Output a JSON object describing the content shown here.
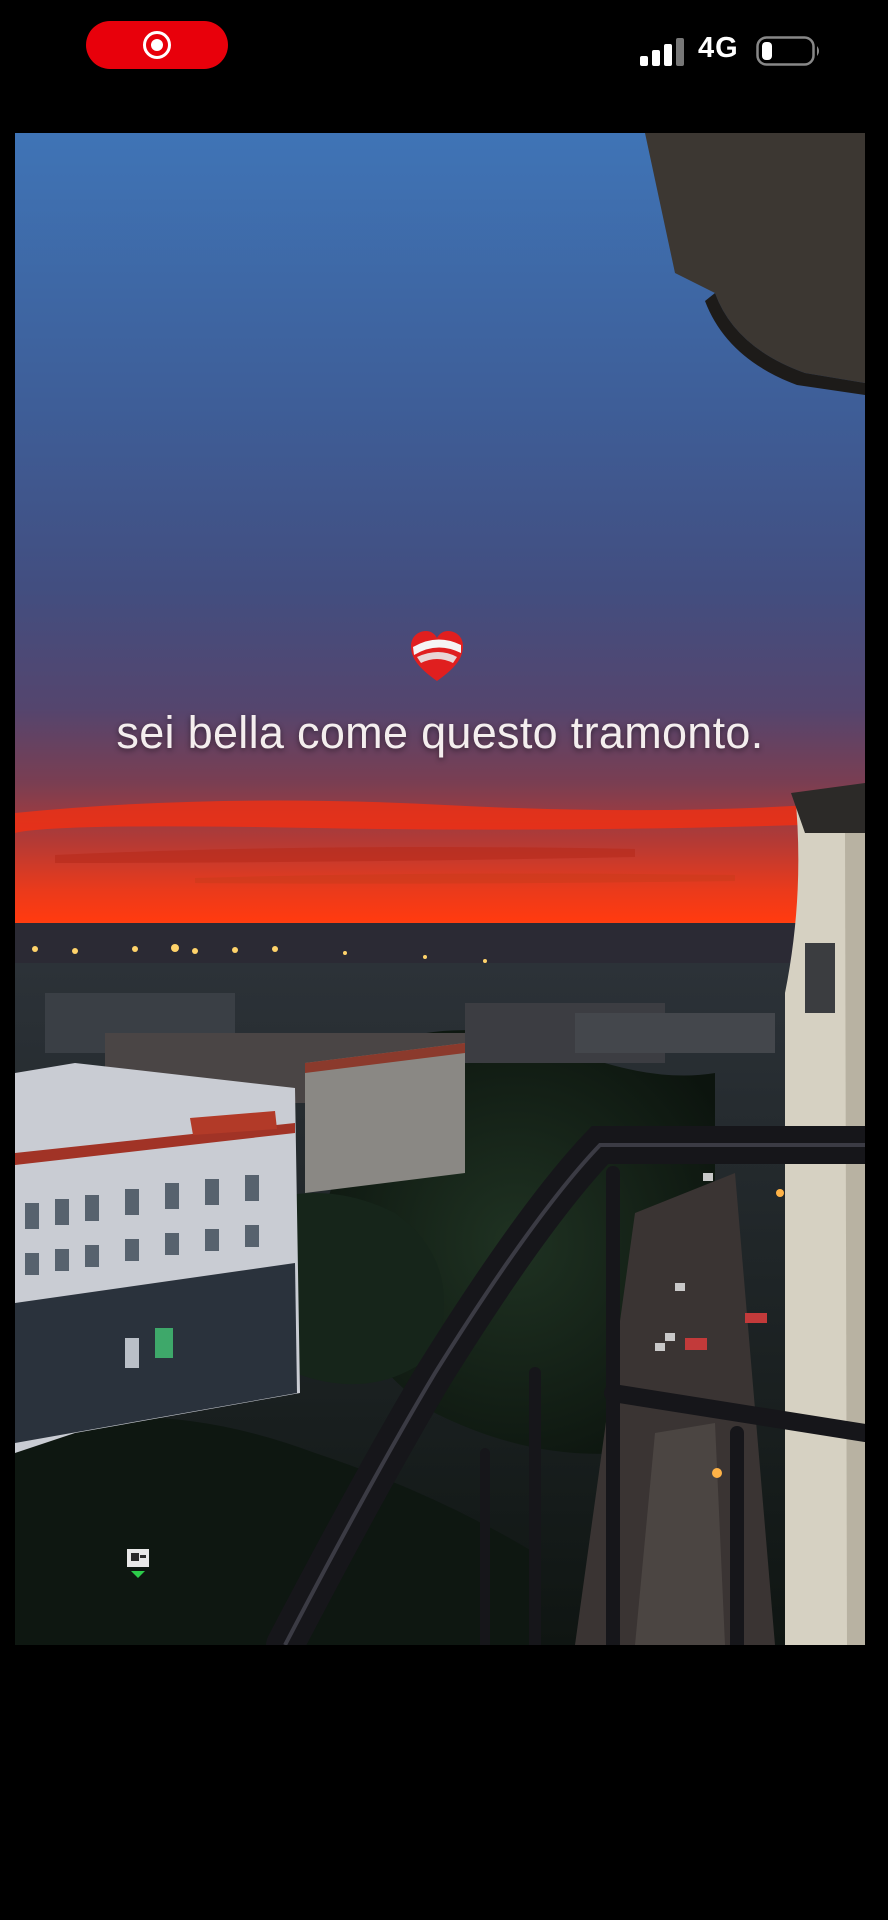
{
  "status_bar": {
    "recording_indicator": "record-icon",
    "network": "4G",
    "signal_icon": "signal-bars-icon",
    "battery_icon": "battery-low-icon",
    "record_color": "#e8000b"
  },
  "video": {
    "caption": "sei bella come questo tramonto.",
    "caption_emoji": "mending-heart-icon",
    "description_colors": {
      "sky_top": "#3e6fae",
      "sunset_band": "#ff3a10"
    }
  }
}
